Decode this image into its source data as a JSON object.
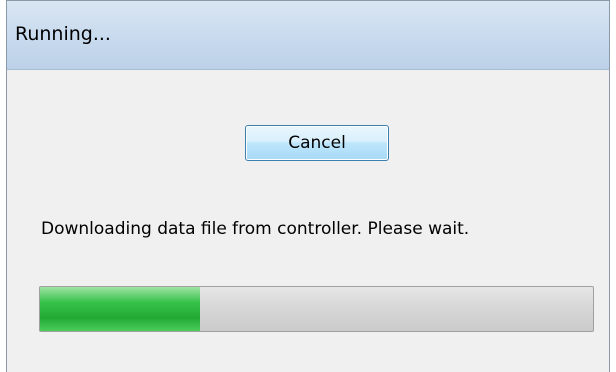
{
  "window": {
    "title": "Running..."
  },
  "dialog": {
    "cancel_label": "Cancel",
    "message": "Downloading data file from controller. Please wait."
  },
  "progress": {
    "fraction": 0.29,
    "fill_color": "#21a934"
  }
}
